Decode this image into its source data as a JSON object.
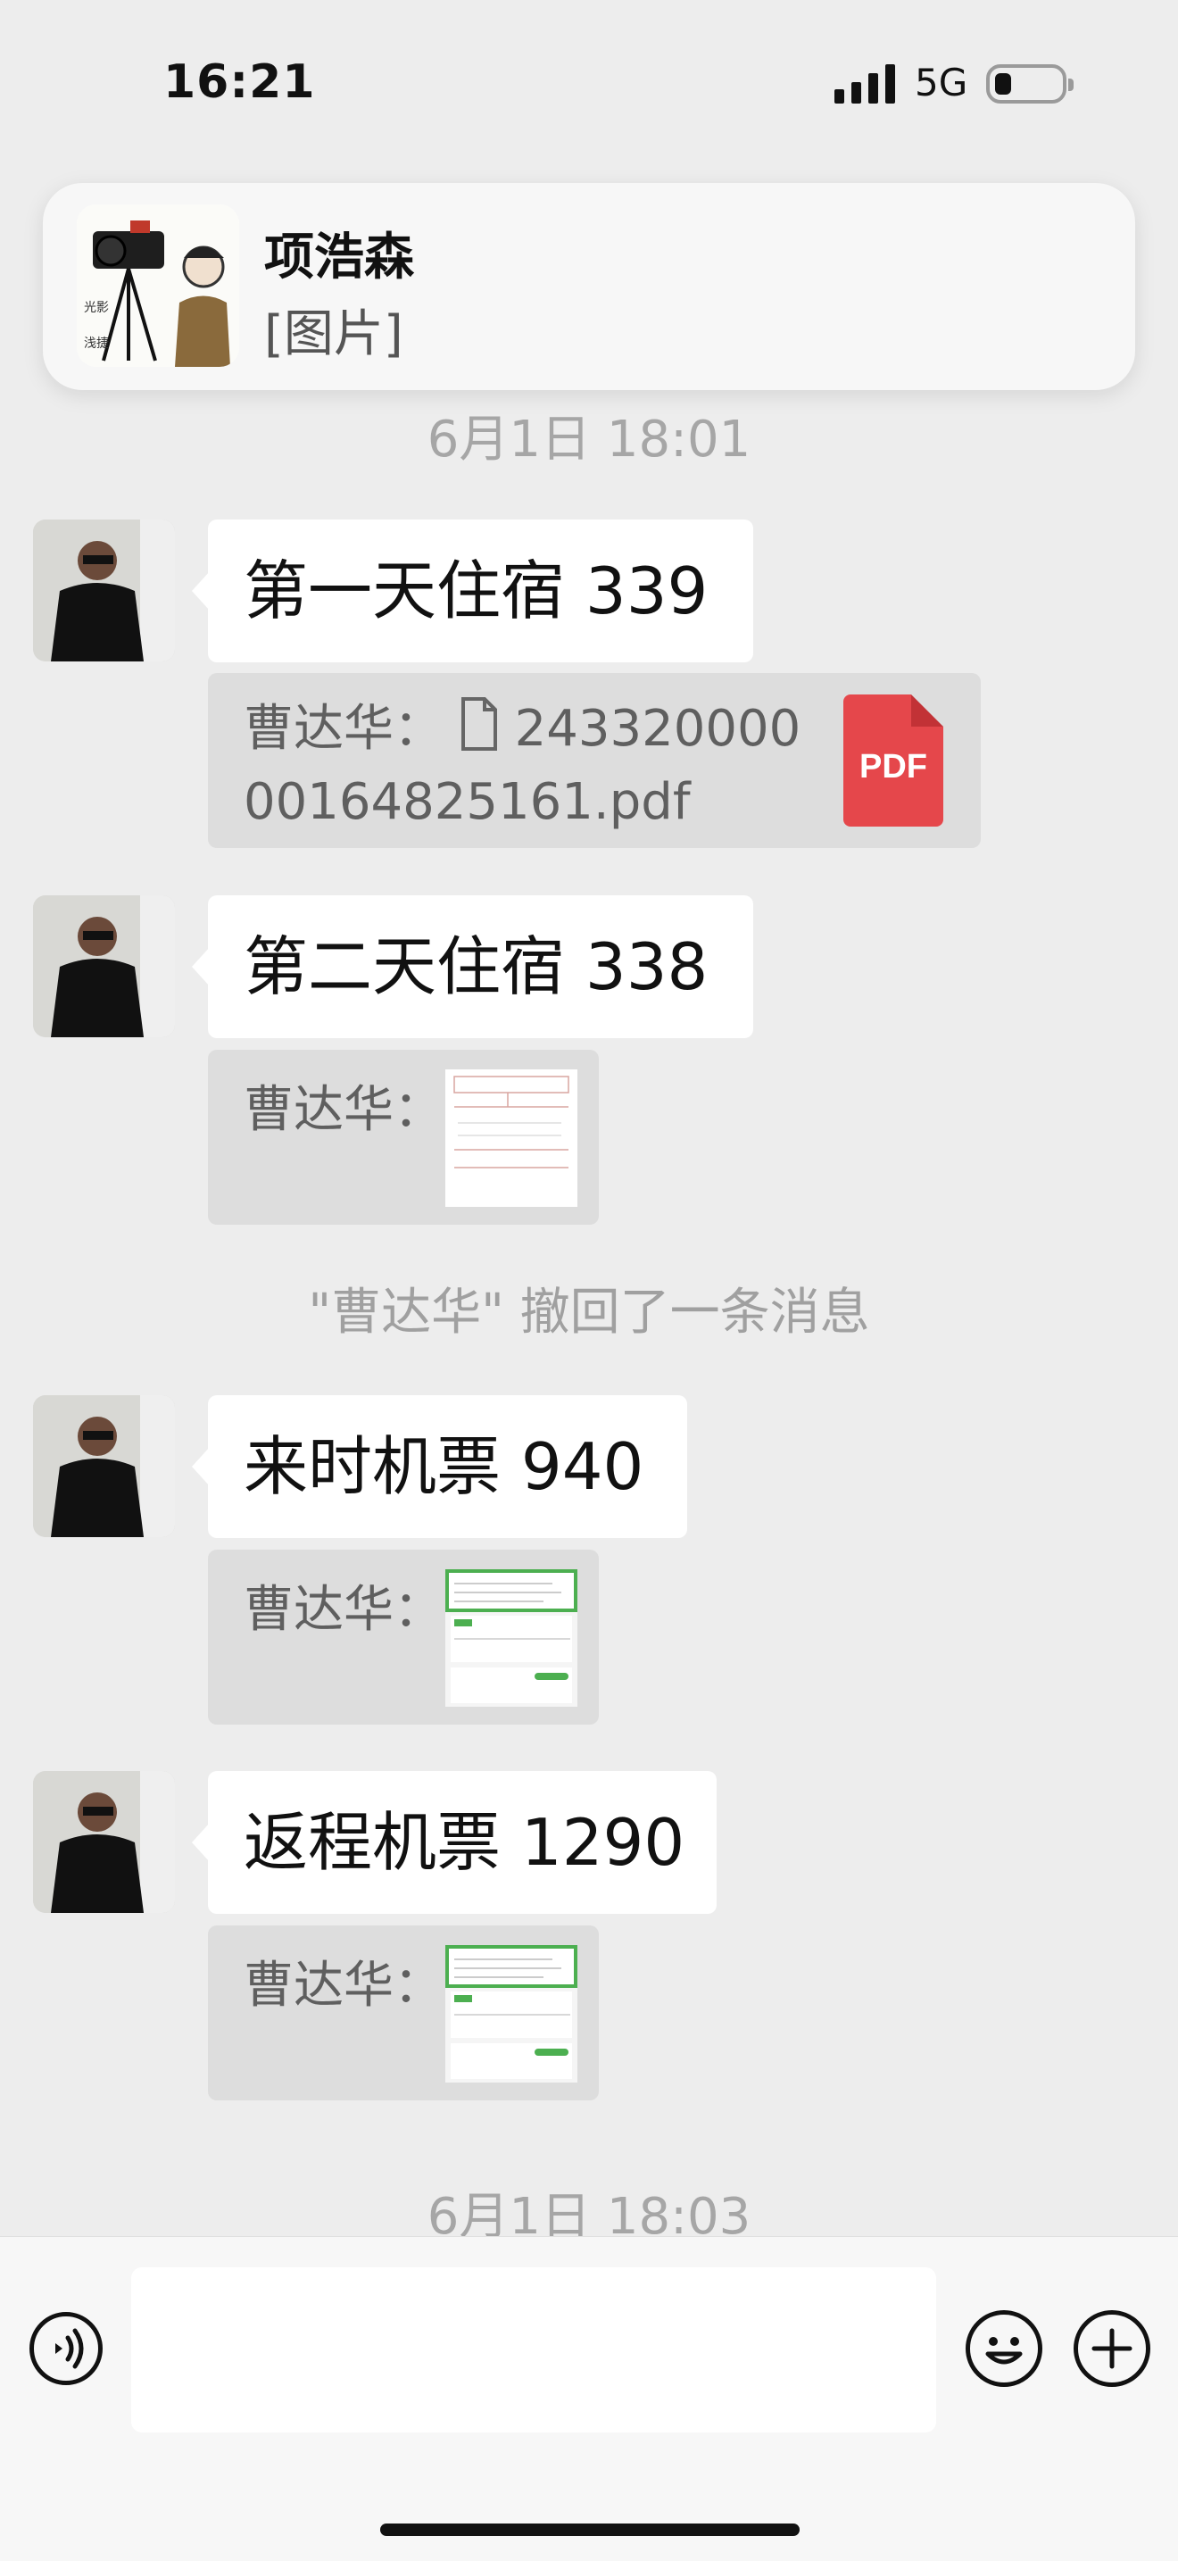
{
  "status_bar": {
    "time": "16:21",
    "network": "5G"
  },
  "notification": {
    "sender": "项浩森",
    "preview": "[图片]"
  },
  "timestamps": [
    "6月1日 18:01",
    "6月1日 18:03"
  ],
  "messages": [
    {
      "text": "第一天住宿 339",
      "quote": {
        "name": "曹达华：",
        "file_line1": "243320000",
        "file_line2": "00164825161.pdf",
        "file_badge": "PDF"
      }
    },
    {
      "text": "第二天住宿 338",
      "quote": {
        "name": "曹达华："
      }
    },
    {
      "text": "来时机票 940",
      "quote": {
        "name": "曹达华："
      }
    },
    {
      "text": "返程机票 1290",
      "quote": {
        "name": "曹达华："
      }
    }
  ],
  "recall_notice": "\"曹达华\" 撤回了一条消息",
  "input": {
    "placeholder": ""
  },
  "colors": {
    "background": "#EDEDED",
    "bubble": "#FFFFFF",
    "quote": "#DDDDDD",
    "pdf": "#E5474B",
    "thumb_accent": "#4CAF50"
  }
}
